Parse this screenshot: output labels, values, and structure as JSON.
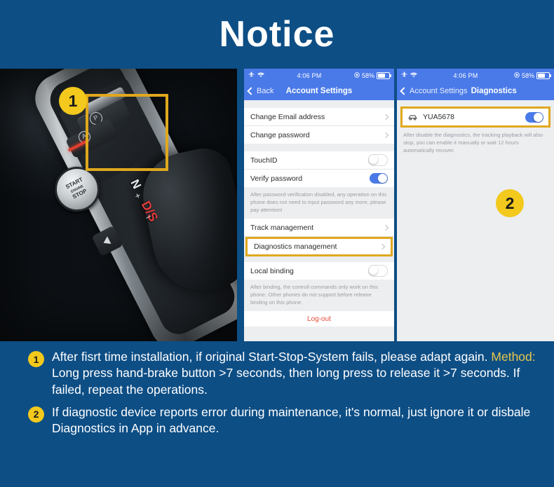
{
  "header": {
    "title": "Notice"
  },
  "photo": {
    "badge": "1",
    "start_button": {
      "line1": "START",
      "line2": "ENGINE",
      "line3": "STOP"
    },
    "gear_letters": [
      "P",
      "R",
      "N",
      "D/S"
    ],
    "plus": "+",
    "minus": "–"
  },
  "phone1": {
    "statusbar": {
      "airplane_icon": "airplane-icon",
      "wifi_icon": "wifi-icon",
      "time": "4:06 PM",
      "location_icon": "location-icon",
      "battery_percent": "58%"
    },
    "navbar": {
      "back_label": "Back",
      "title": "Account Settings"
    },
    "group1": [
      {
        "label": "Change Email address",
        "accessory": "chevron"
      },
      {
        "label": "Change password",
        "accessory": "chevron"
      }
    ],
    "group2": [
      {
        "label": "TouchID",
        "accessory": "toggle",
        "on": false
      },
      {
        "label": "Verify password",
        "accessory": "toggle",
        "on": true
      }
    ],
    "note1": "After password verification disabled, any operation on this phone does not need to input password any more, please pay attention!",
    "group3": [
      {
        "label": "Track management",
        "accessory": "chevron",
        "highlight": false
      },
      {
        "label": "Diagnostics management",
        "accessory": "chevron",
        "highlight": true
      }
    ],
    "group4": [
      {
        "label": "Local binding",
        "accessory": "toggle",
        "on": false
      }
    ],
    "note2": "After binding, the controll commands only work on this phone. Other phones do not support before release binding on this phone.",
    "logout_label": "Log-out"
  },
  "phone2": {
    "statusbar": {
      "airplane_icon": "airplane-icon",
      "wifi_icon": "wifi-icon",
      "time": "4:06 PM",
      "location_icon": "location-icon",
      "battery_percent": "58%"
    },
    "navbar": {
      "back_label": "Account Settings",
      "title": "Diagnostics"
    },
    "device": {
      "icon": "car-icon",
      "name": "YUA5678",
      "toggle_on": true
    },
    "note": "After disable the diagnostics, the tracking playback will also stop, you can enable it manually or wait 12 hours automatically recover.",
    "badge": "2"
  },
  "notes": [
    {
      "badge": "1",
      "text_before": "After fisrt time installation, if original Start-Stop-System fails, please adapt again. ",
      "highlight": "Method:",
      "text_after": " Long press hand-brake button >7 seconds, then long press to release it >7 seconds. If failed, repeat the operations."
    },
    {
      "badge": "2",
      "text_before": "If diagnostic device reports error during maintenance, it's normal, just ignore it or disbale Diagnostics in App in advance.",
      "highlight": "",
      "text_after": ""
    }
  ],
  "colors": {
    "background_blue": "#0d4e85",
    "accent_yellow": "#f2c91c",
    "highlight_border": "#e0a81e",
    "ios_blue": "#4a7ae8",
    "logout_red": "#e8493a",
    "method_gold": "#e8c84a"
  }
}
